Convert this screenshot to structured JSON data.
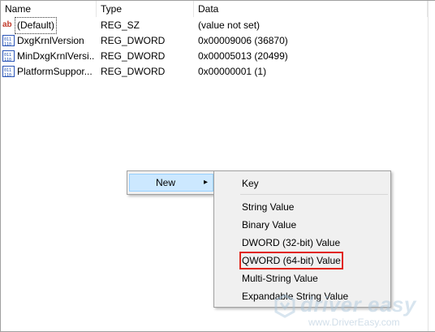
{
  "columns": {
    "name": "Name",
    "type": "Type",
    "data": "Data"
  },
  "rows": [
    {
      "icon": "string-value-icon",
      "icon_text": "ab",
      "name": "(Default)",
      "type": "REG_SZ",
      "data": "(value not set)"
    },
    {
      "icon": "binary-value-icon",
      "name": "DxgKrnlVersion",
      "type": "REG_DWORD",
      "data": "0x00009006 (36870)"
    },
    {
      "icon": "binary-value-icon",
      "name": "MinDxgKrnlVersi...",
      "type": "REG_DWORD",
      "data": "0x00005013 (20499)"
    },
    {
      "icon": "binary-value-icon",
      "name": "PlatformSuppor...",
      "type": "REG_DWORD",
      "data": "0x00000001 (1)"
    }
  ],
  "context_menu": {
    "new_label": "New",
    "arrow_icon": "chevron-right-icon"
  },
  "submenu": {
    "items": [
      "Key",
      "String Value",
      "Binary Value",
      "DWORD (32-bit) Value",
      "QWORD (64-bit) Value",
      "Multi-String Value",
      "Expandable String Value"
    ],
    "highlighted": "QWORD (64-bit) Value",
    "highlight_color": "#e1261c"
  },
  "watermark": {
    "brand": "driver easy",
    "url": "www.DriverEasy.com"
  }
}
